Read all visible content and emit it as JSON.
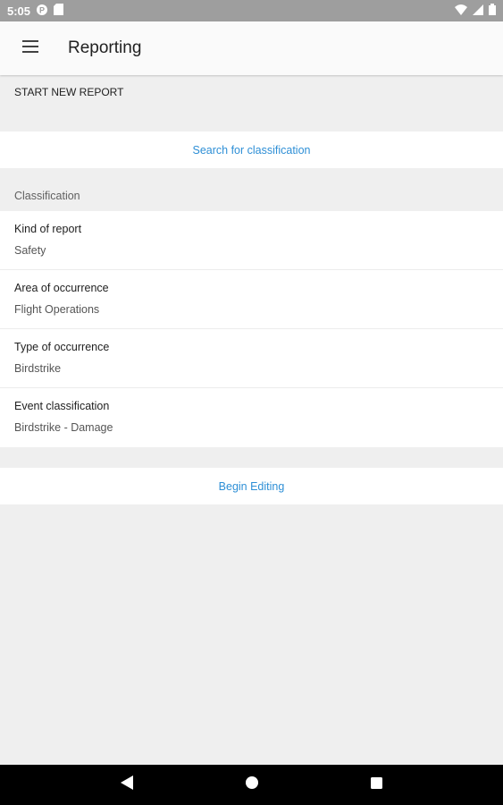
{
  "status_bar": {
    "time": "5:05",
    "icons": [
      "cast-icon",
      "sd-card-icon",
      "wifi-icon",
      "signal-icon",
      "battery-icon"
    ]
  },
  "app_bar": {
    "title": "Reporting",
    "menu_icon": "hamburger-menu-icon"
  },
  "new_report": {
    "section_title": "START NEW REPORT",
    "search_label": "Search for classification"
  },
  "classification": {
    "group_title": "Classification",
    "items": [
      {
        "label": "Kind of report",
        "value": "Safety"
      },
      {
        "label": "Area of occurrence",
        "value": "Flight Operations"
      },
      {
        "label": "Type of occurrence",
        "value": "Birdstrike"
      },
      {
        "label": "Event classification",
        "value": "Birdstrike - Damage"
      }
    ]
  },
  "actions": {
    "begin_editing_label": "Begin Editing"
  },
  "nav_bar": {
    "icons": [
      "back-icon",
      "home-icon",
      "recents-icon"
    ]
  },
  "colors": {
    "accent": "#2e8fd6",
    "background": "#efefef",
    "status_bar": "#9e9e9e",
    "app_bar": "#fafafa"
  }
}
